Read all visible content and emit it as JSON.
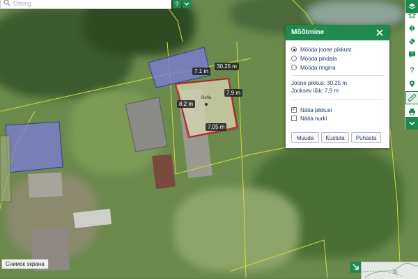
{
  "search": {
    "placeholder": "Otsing",
    "help_label": "?"
  },
  "toolbar": {
    "tools": [
      {
        "name": "layers",
        "icon": "layers-icon"
      },
      {
        "name": "favorites",
        "icon": "star-icon"
      },
      {
        "name": "split-view",
        "icon": "split-view-icon"
      },
      {
        "name": "eraser",
        "icon": "eraser-icon"
      },
      {
        "name": "feedback",
        "icon": "feedback-icon"
      },
      {
        "name": "help",
        "icon": "help-icon"
      },
      {
        "name": "location",
        "icon": "location-pin-icon"
      },
      {
        "name": "measure",
        "icon": "ruler-icon",
        "active": true
      },
      {
        "name": "print",
        "icon": "printer-icon"
      },
      {
        "name": "collapse",
        "icon": "chevron-down-icon"
      }
    ]
  },
  "measure_panel": {
    "title": "Mõõtmine",
    "modes": [
      {
        "label": "Mööda joone pikkust",
        "selected": true
      },
      {
        "label": "Mööda pindala",
        "selected": false
      },
      {
        "label": "Mööda ringina",
        "selected": false
      }
    ],
    "result": {
      "line_length": "Joone pikkus: 30.25 m",
      "current_segment": "Jooksev lõik: 7.9 m"
    },
    "options": [
      {
        "label": "Näita pikkusi",
        "checked": true
      },
      {
        "label": "Näita nurki",
        "checked": false
      }
    ],
    "buttons": {
      "edit": "Muuda",
      "delete": "Kustuta",
      "clear": "Puhasta"
    }
  },
  "map": {
    "labels": {
      "total": "30.25 m",
      "top": "7.1 m",
      "right": "7.9 m",
      "left": "8.2 m",
      "bottom": "7.05 m",
      "building": "Stefla"
    },
    "colors": {
      "measure_line": "#d9232e",
      "cadastral_border": "#d8d83a",
      "building_fill": "#7c7cd6"
    }
  },
  "footer": {
    "screenshot_label": "Снимок экрана"
  }
}
